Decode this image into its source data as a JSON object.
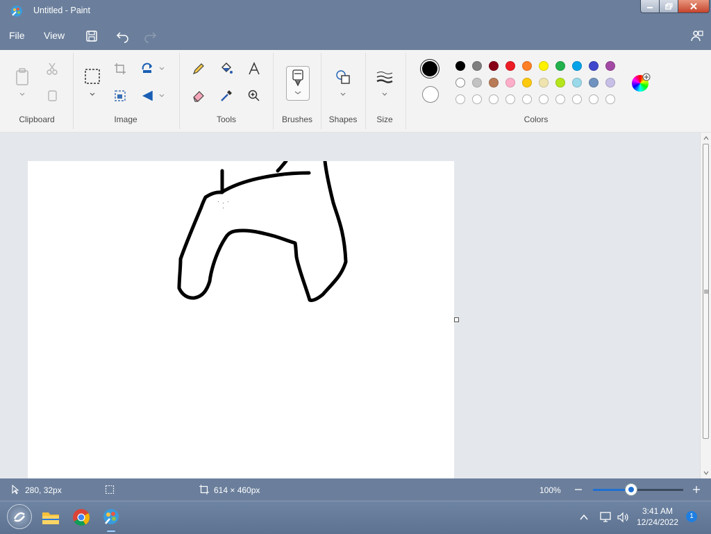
{
  "window": {
    "title": "Untitled - Paint"
  },
  "menu": {
    "file": "File",
    "view": "View"
  },
  "ribbon": {
    "groups": {
      "clipboard": "Clipboard",
      "image": "Image",
      "tools": "Tools",
      "brushes": "Brushes",
      "shapes": "Shapes",
      "size": "Size",
      "colors": "Colors"
    }
  },
  "colors": {
    "primary": "#000000",
    "secondary": "#ffffff",
    "row1": [
      "#000000",
      "#7f7f7f",
      "#880015",
      "#ed1c24",
      "#ff7f27",
      "#fff200",
      "#22b14c",
      "#00a2e8",
      "#3f48cc",
      "#a349a4"
    ],
    "row2": [
      "#ffffff",
      "#c3c3c3",
      "#b97a57",
      "#ffaec9",
      "#ffc90e",
      "#efe4b0",
      "#b5e61d",
      "#99d9ea",
      "#7092be",
      "#c8bfe7"
    ],
    "row3_count_label": "empty custom slots"
  },
  "status": {
    "cursor_position": "280, 32px",
    "canvas_size": "614 × 460px",
    "zoom": "100%",
    "zoom_level": 0.42
  },
  "taskbar": {
    "time": "3:41 AM",
    "date": "12/24/2022",
    "notification_count": "1"
  }
}
